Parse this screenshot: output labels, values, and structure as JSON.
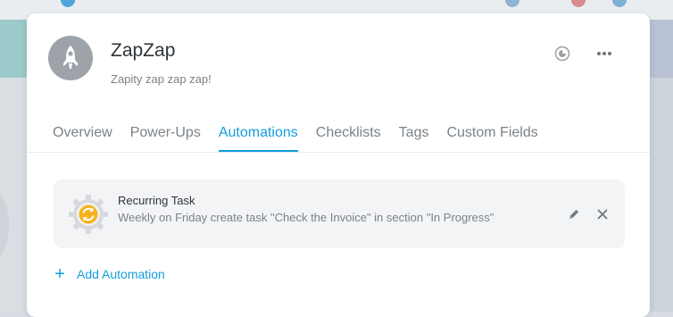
{
  "project": {
    "title": "ZapZap",
    "subtitle": "Zapity zap zap zap!"
  },
  "header_icons": [
    "watch-icon",
    "more-options-icon"
  ],
  "tabs": [
    {
      "label": "Overview",
      "active": false
    },
    {
      "label": "Power-Ups",
      "active": false
    },
    {
      "label": "Automations",
      "active": true
    },
    {
      "label": "Checklists",
      "active": false
    },
    {
      "label": "Tags",
      "active": false
    },
    {
      "label": "Custom Fields",
      "active": false
    }
  ],
  "automations": [
    {
      "title": "Recurring Task",
      "description": "Weekly on Friday create task \"Check the Invoice\" in section \"In Progress\"",
      "icon": "recurring-gear-icon"
    }
  ],
  "add_automation_label": "Add Automation",
  "colors": {
    "accent": "#139edb",
    "recurring_icon": "#f5b21c",
    "avatar_bg": "#9da3a9"
  }
}
